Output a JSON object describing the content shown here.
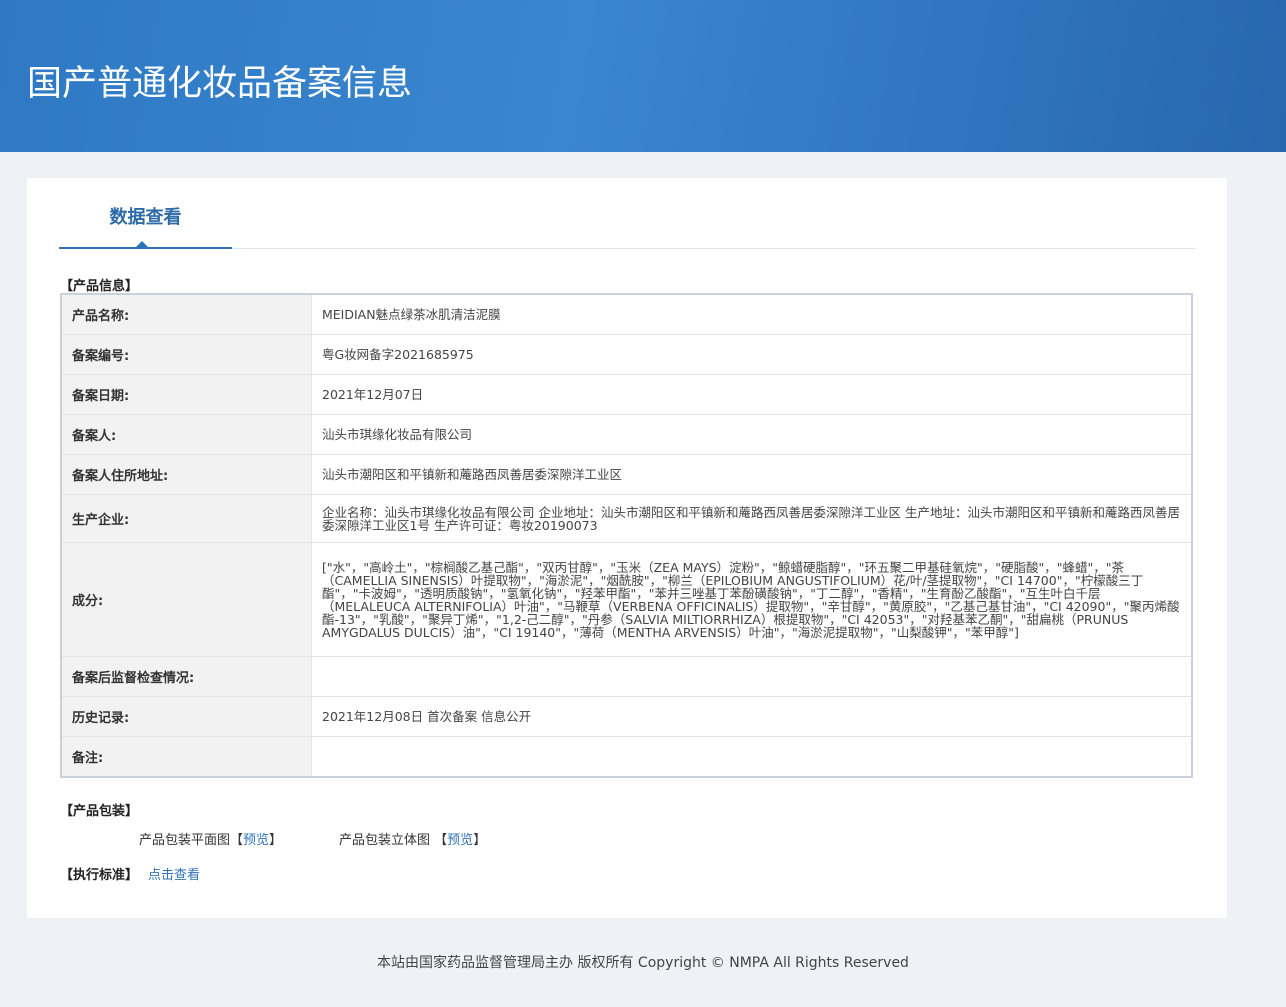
{
  "header": {
    "title": "国产普通化妆品备案信息"
  },
  "tab": "数据查看",
  "sections": {
    "product_info": "【产品信息】",
    "packaging": "【产品包装】",
    "standard": "【执行标准】"
  },
  "rows": [
    {
      "label": "产品名称:",
      "value": "MEIDIAN魅点绿茶冰肌清洁泥膜"
    },
    {
      "label": "备案编号:",
      "value": "粤G妆网备字2021685975"
    },
    {
      "label": "备案日期:",
      "value": "2021年12月07日"
    },
    {
      "label": "备案人:",
      "value": "汕头市琪缘化妆品有限公司"
    },
    {
      "label": "备案人住所地址:",
      "value": "汕头市潮阳区和平镇新和蓭路西凤善居委深隙洋工业区"
    },
    {
      "label": "生产企业:",
      "value": "企业名称：汕头市琪缘化妆品有限公司 企业地址：汕头市潮阳区和平镇新和蓭路西凤善居委深隙洋工业区 生产地址：汕头市潮阳区和平镇新和蓭路西凤善居委深隙洋工业区1号 生产许可证：粤妆20190073"
    },
    {
      "label": "成分:",
      "value": "[\"水\"，\"高岭土\"，\"棕榈酸乙基己酯\"，\"双丙甘醇\"，\"玉米（ZEA MAYS）淀粉\"，\"鲸蜡硬脂醇\"，\"环五聚二甲基硅氧烷\"，\"硬脂酸\"，\"蜂蜡\"，\"茶（CAMELLIA SINENSIS）叶提取物\"，\"海淤泥\"，\"烟酰胺\"，\"柳兰（EPILOBIUM ANGUSTIFOLIUM）花/叶/茎提取物\"，\"CI 14700\"，\"柠檬酸三丁酯\"，\"卡波姆\"，\"透明质酸钠\"，\"氢氧化钠\"，\"羟苯甲酯\"，\"苯并三唑基丁苯酚磺酸钠\"，\"丁二醇\"，\"香精\"，\"生育酚乙酸酯\"，\"互生叶白千层（MELALEUCA ALTERNIFOLIA）叶油\"，\"马鞭草（VERBENA OFFICINALIS）提取物\"，\"辛甘醇\"，\"黄原胶\"，\"乙基己基甘油\"，\"CI 42090\"，\"聚丙烯酸酯-13\"，\"乳酸\"，\"聚异丁烯\"，\"1,2-己二醇\"，\"丹参（SALVIA MILTIORRHIZA）根提取物\"，\"CI 42053\"，\"对羟基苯乙酮\"，\"甜扁桃（PRUNUS AMYGDALUS DULCIS）油\"，\"CI 19140\"，\"薄荷（MENTHA ARVENSIS）叶油\"，\"海淤泥提取物\"，\"山梨酸钾\"，\"苯甲醇\"]"
    },
    {
      "label": "备案后监督检查情况:",
      "value": ""
    },
    {
      "label": "历史记录:",
      "value": "2021年12月08日 首次备案 信息公开"
    },
    {
      "label": "备注:",
      "value": ""
    }
  ],
  "packaging": {
    "flat_label": "产品包装平面图",
    "solid_label": "产品包装立体图",
    "open": "【",
    "close": "】",
    "preview": "预览"
  },
  "standard_link": "点击查看",
  "footer": "本站由国家药品监督管理局主办 版权所有 Copyright © NMPA All Rights Reserved"
}
